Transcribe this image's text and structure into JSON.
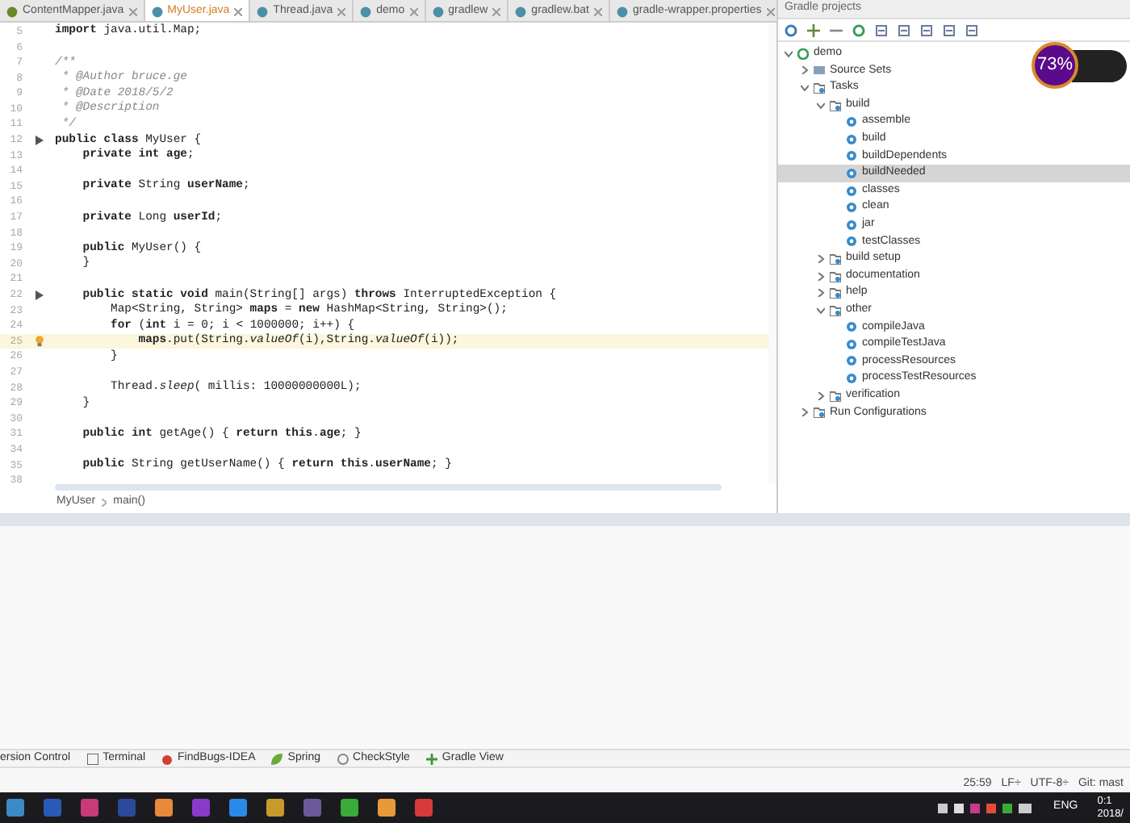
{
  "editor_tabs": [
    {
      "label": "ContentMapper.java",
      "selected": false
    },
    {
      "label": "MyUser.java",
      "selected": true
    },
    {
      "label": "Thread.java",
      "selected": false
    },
    {
      "label": "demo",
      "selected": false
    },
    {
      "label": "gradlew",
      "selected": false
    },
    {
      "label": "gradlew.bat",
      "selected": false
    },
    {
      "label": "gradle-wrapper.properties",
      "selected": false
    }
  ],
  "code_lines": [
    {
      "number": "5",
      "text": "**import** java.util.Map;",
      "highlighted": false,
      "kind": "plain"
    },
    {
      "number": "6",
      "highlighted": false,
      "kind": "plain"
    },
    {
      "number": "7",
      "text": "/**",
      "highlighted": false,
      "kind": "comment"
    },
    {
      "number": "8",
      "text": " * @Author bruce.ge",
      "highlighted": false,
      "kind": "comment"
    },
    {
      "number": "9",
      "text": " * @Date 2018/5/2",
      "highlighted": false,
      "kind": "comment"
    },
    {
      "number": "10",
      "text": " * @Description",
      "highlighted": false,
      "kind": "comment"
    },
    {
      "number": "11",
      "text": " */",
      "highlighted": false,
      "kind": "comment"
    },
    {
      "number": "12",
      "text": "**public class** MyUser {",
      "highlighted": false,
      "kind": "run"
    },
    {
      "number": "13",
      "text": "    **private int age**;",
      "highlighted": false,
      "kind": "plain"
    },
    {
      "number": "14",
      "highlighted": false,
      "kind": "plain"
    },
    {
      "number": "15",
      "text": "    **private** String **userName**;",
      "highlighted": false,
      "kind": "plain"
    },
    {
      "number": "16",
      "highlighted": false,
      "kind": "plain"
    },
    {
      "number": "17",
      "text": "    **private** Long **userId**;",
      "highlighted": false,
      "kind": "plain"
    },
    {
      "number": "18",
      "highlighted": false,
      "kind": "plain"
    },
    {
      "number": "19",
      "text": "    **public** MyUser() {",
      "highlighted": false,
      "kind": "plain"
    },
    {
      "number": "20",
      "text": "    }",
      "highlighted": false,
      "kind": "plain"
    },
    {
      "number": "21",
      "highlighted": false,
      "kind": "plain"
    },
    {
      "number": "22",
      "text": "    **public static void** main(String[] args) **throws** InterruptedException {",
      "highlighted": false,
      "kind": "run"
    },
    {
      "number": "23",
      "text": "        Map<String, String> **maps** = **new** HashMap<String, String>();",
      "highlighted": false,
      "kind": "plain"
    },
    {
      "number": "24",
      "text": "        **for** (**int** i = 0; i < 1000000; i++) {",
      "highlighted": false,
      "kind": "plain"
    },
    {
      "number": "25",
      "text": "            **maps**.put(String.*valueOf*(i),String.*valueOf*(i));",
      "highlighted": true,
      "kind": "bulb"
    },
    {
      "number": "26",
      "text": "        }",
      "highlighted": false,
      "kind": "plain"
    },
    {
      "number": "27",
      "highlighted": false,
      "kind": "plain"
    },
    {
      "number": "28",
      "text": "        Thread.*sleep*( millis: 10000000000L);",
      "highlighted": false,
      "kind": "plain"
    },
    {
      "number": "29",
      "text": "    }",
      "highlighted": false,
      "kind": "plain"
    },
    {
      "number": "30",
      "highlighted": false,
      "kind": "plain"
    },
    {
      "number": "31",
      "text": "    **public int** getAge() { **return this**.**age**; }",
      "highlighted": false,
      "kind": "plain"
    },
    {
      "number": "34",
      "highlighted": false,
      "kind": "plain"
    },
    {
      "number": "35",
      "text": "    **public** String getUserName() { **return this**.**userName**; }",
      "highlighted": false,
      "kind": "plain"
    },
    {
      "number": "38",
      "highlighted": false,
      "kind": "plain"
    }
  ],
  "breadcrumbs": [
    "MyUser",
    "main()"
  ],
  "gradle_panel": {
    "title": "Gradle projects",
    "tree": [
      {
        "label": "demo",
        "kind": "project",
        "expanded": true,
        "selected": false,
        "children": [
          {
            "label": "Source Sets",
            "kind": "sources",
            "expanded": false,
            "selected": false
          },
          {
            "label": "Tasks",
            "kind": "folder",
            "expanded": true,
            "selected": false,
            "children": [
              {
                "label": "build",
                "kind": "folder",
                "expanded": true,
                "selected": false,
                "children": [
                  {
                    "label": "assemble",
                    "kind": "task",
                    "selected": false
                  },
                  {
                    "label": "build",
                    "kind": "task",
                    "selected": false
                  },
                  {
                    "label": "buildDependents",
                    "kind": "task",
                    "selected": false
                  },
                  {
                    "label": "buildNeeded",
                    "kind": "task",
                    "selected": true
                  },
                  {
                    "label": "classes",
                    "kind": "task",
                    "selected": false
                  },
                  {
                    "label": "clean",
                    "kind": "task",
                    "selected": false
                  },
                  {
                    "label": "jar",
                    "kind": "task",
                    "selected": false
                  },
                  {
                    "label": "testClasses",
                    "kind": "task",
                    "selected": false
                  }
                ]
              },
              {
                "label": "build setup",
                "kind": "folder",
                "expanded": false,
                "selected": false
              },
              {
                "label": "documentation",
                "kind": "folder",
                "expanded": false,
                "selected": false
              },
              {
                "label": "help",
                "kind": "folder",
                "expanded": false,
                "selected": false
              },
              {
                "label": "other",
                "kind": "folder",
                "expanded": true,
                "selected": false,
                "children": [
                  {
                    "label": "compileJava",
                    "kind": "task",
                    "selected": false
                  },
                  {
                    "label": "compileTestJava",
                    "kind": "task",
                    "selected": false
                  },
                  {
                    "label": "processResources",
                    "kind": "task",
                    "selected": false
                  },
                  {
                    "label": "processTestResources",
                    "kind": "task",
                    "selected": false
                  }
                ]
              },
              {
                "label": "verification",
                "kind": "folder",
                "expanded": false,
                "selected": false
              }
            ]
          },
          {
            "label": "Run Configurations",
            "kind": "folder",
            "expanded": false,
            "selected": false
          }
        ]
      }
    ]
  },
  "speed_widget": {
    "percent": "73%"
  },
  "tool_windows": [
    "ersion Control",
    "Terminal",
    "FindBugs-IDEA",
    "Spring",
    "CheckStyle",
    "Gradle View"
  ],
  "status_bar": [
    "25:59",
    "LF÷",
    "UTF-8÷",
    "Git: mast"
  ],
  "taskbar": {
    "language": "ENG",
    "time": "0:1",
    "date": "2018/"
  }
}
